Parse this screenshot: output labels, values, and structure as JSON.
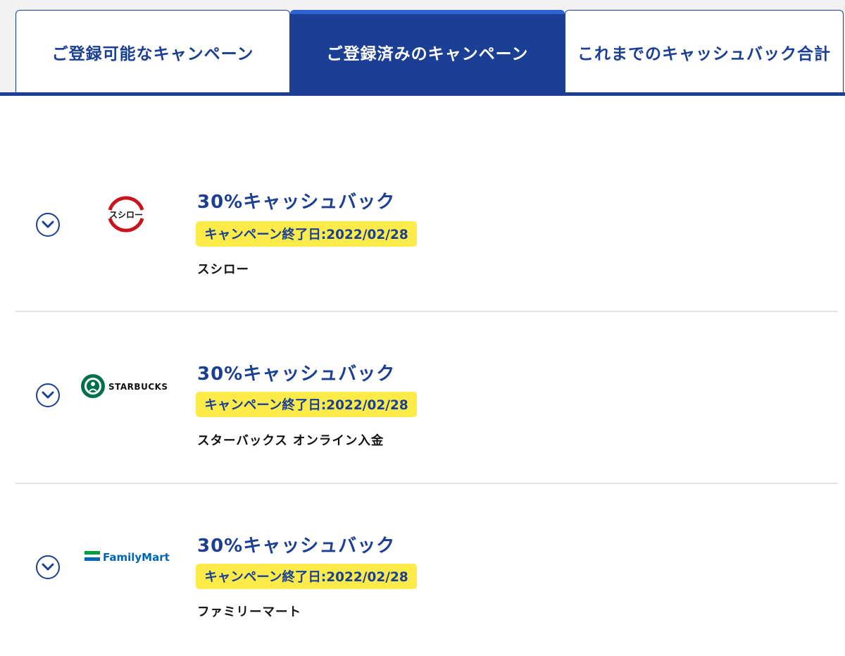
{
  "tabs": [
    {
      "label": "ご登録可能なキャンペーン",
      "active": false
    },
    {
      "label": "ご登録済みのキャンペーン",
      "active": true
    },
    {
      "label": "これまでのキャッシュバック合計",
      "active": false
    }
  ],
  "campaigns": [
    {
      "offer": "30%キャッシュバック",
      "end_date": "キャンペーン終了日:2022/02/28",
      "store": "スシロー",
      "logo_text": "スシロー"
    },
    {
      "offer": "30%キャッシュバック",
      "end_date": "キャンペーン終了日:2022/02/28",
      "store": "スターバックス オンライン入金",
      "logo_text": "STARBUCKS"
    },
    {
      "offer": "30%キャッシュバック",
      "end_date": "キャンペーン終了日:2022/02/28",
      "store": "ファミリーマート",
      "logo_text": "FamilyMart"
    }
  ],
  "icons": {
    "toggle": "chevron-down-circle-icon"
  },
  "colors": {
    "navy": "#1b3f94",
    "badge_yellow": "#fdeb4a",
    "sushiro_red": "#c8141c",
    "starbucks_green": "#00704a",
    "familymart_blue": "#0066b3",
    "familymart_green": "#00a040"
  }
}
